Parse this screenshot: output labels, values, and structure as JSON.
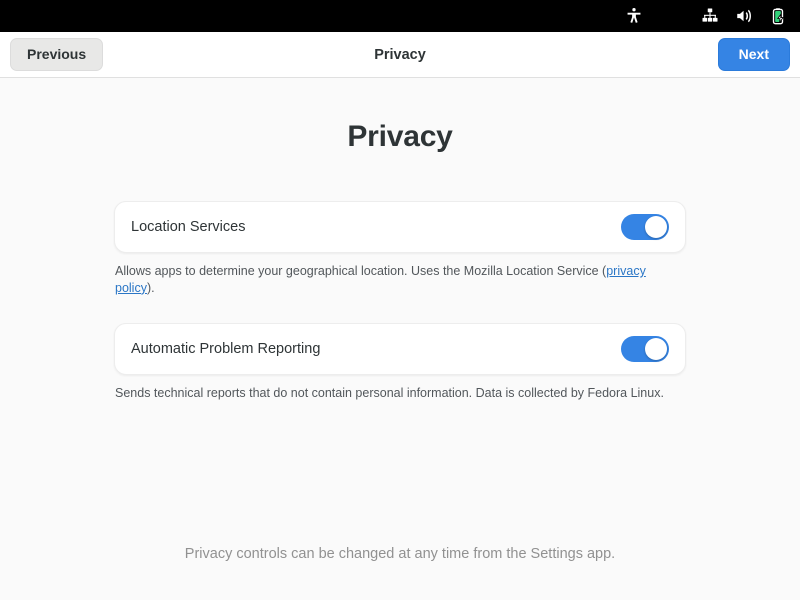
{
  "top_bar": {
    "icons": [
      {
        "name": "accessibility-icon",
        "label": "Accessibility"
      },
      {
        "name": "wired-network-icon",
        "label": "Wired Network"
      },
      {
        "name": "volume-icon",
        "label": "Volume"
      },
      {
        "name": "battery-charging-icon",
        "label": "Battery Charging"
      }
    ],
    "background_color": "#000000",
    "battery_fill_color": "#33d17a"
  },
  "header": {
    "title": "Privacy",
    "previous_label": "Previous",
    "next_label": "Next",
    "next_accent_color": "#3584e4"
  },
  "main": {
    "page_title": "Privacy",
    "rows": [
      {
        "label": "Location Services",
        "toggle_state": "on",
        "description_before_link": "Allows apps to determine your geographical location. Uses the Mozilla Location Service (",
        "link_text": "privacy policy",
        "description_after_link": ")."
      },
      {
        "label": "Automatic Problem Reporting",
        "toggle_state": "on",
        "description_before_link": "Sends technical reports that do not contain personal information. Data is collected by Fedora Linux.",
        "link_text": "",
        "description_after_link": ""
      }
    ],
    "footer_note": "Privacy controls can be changed at any time from the Settings app."
  }
}
